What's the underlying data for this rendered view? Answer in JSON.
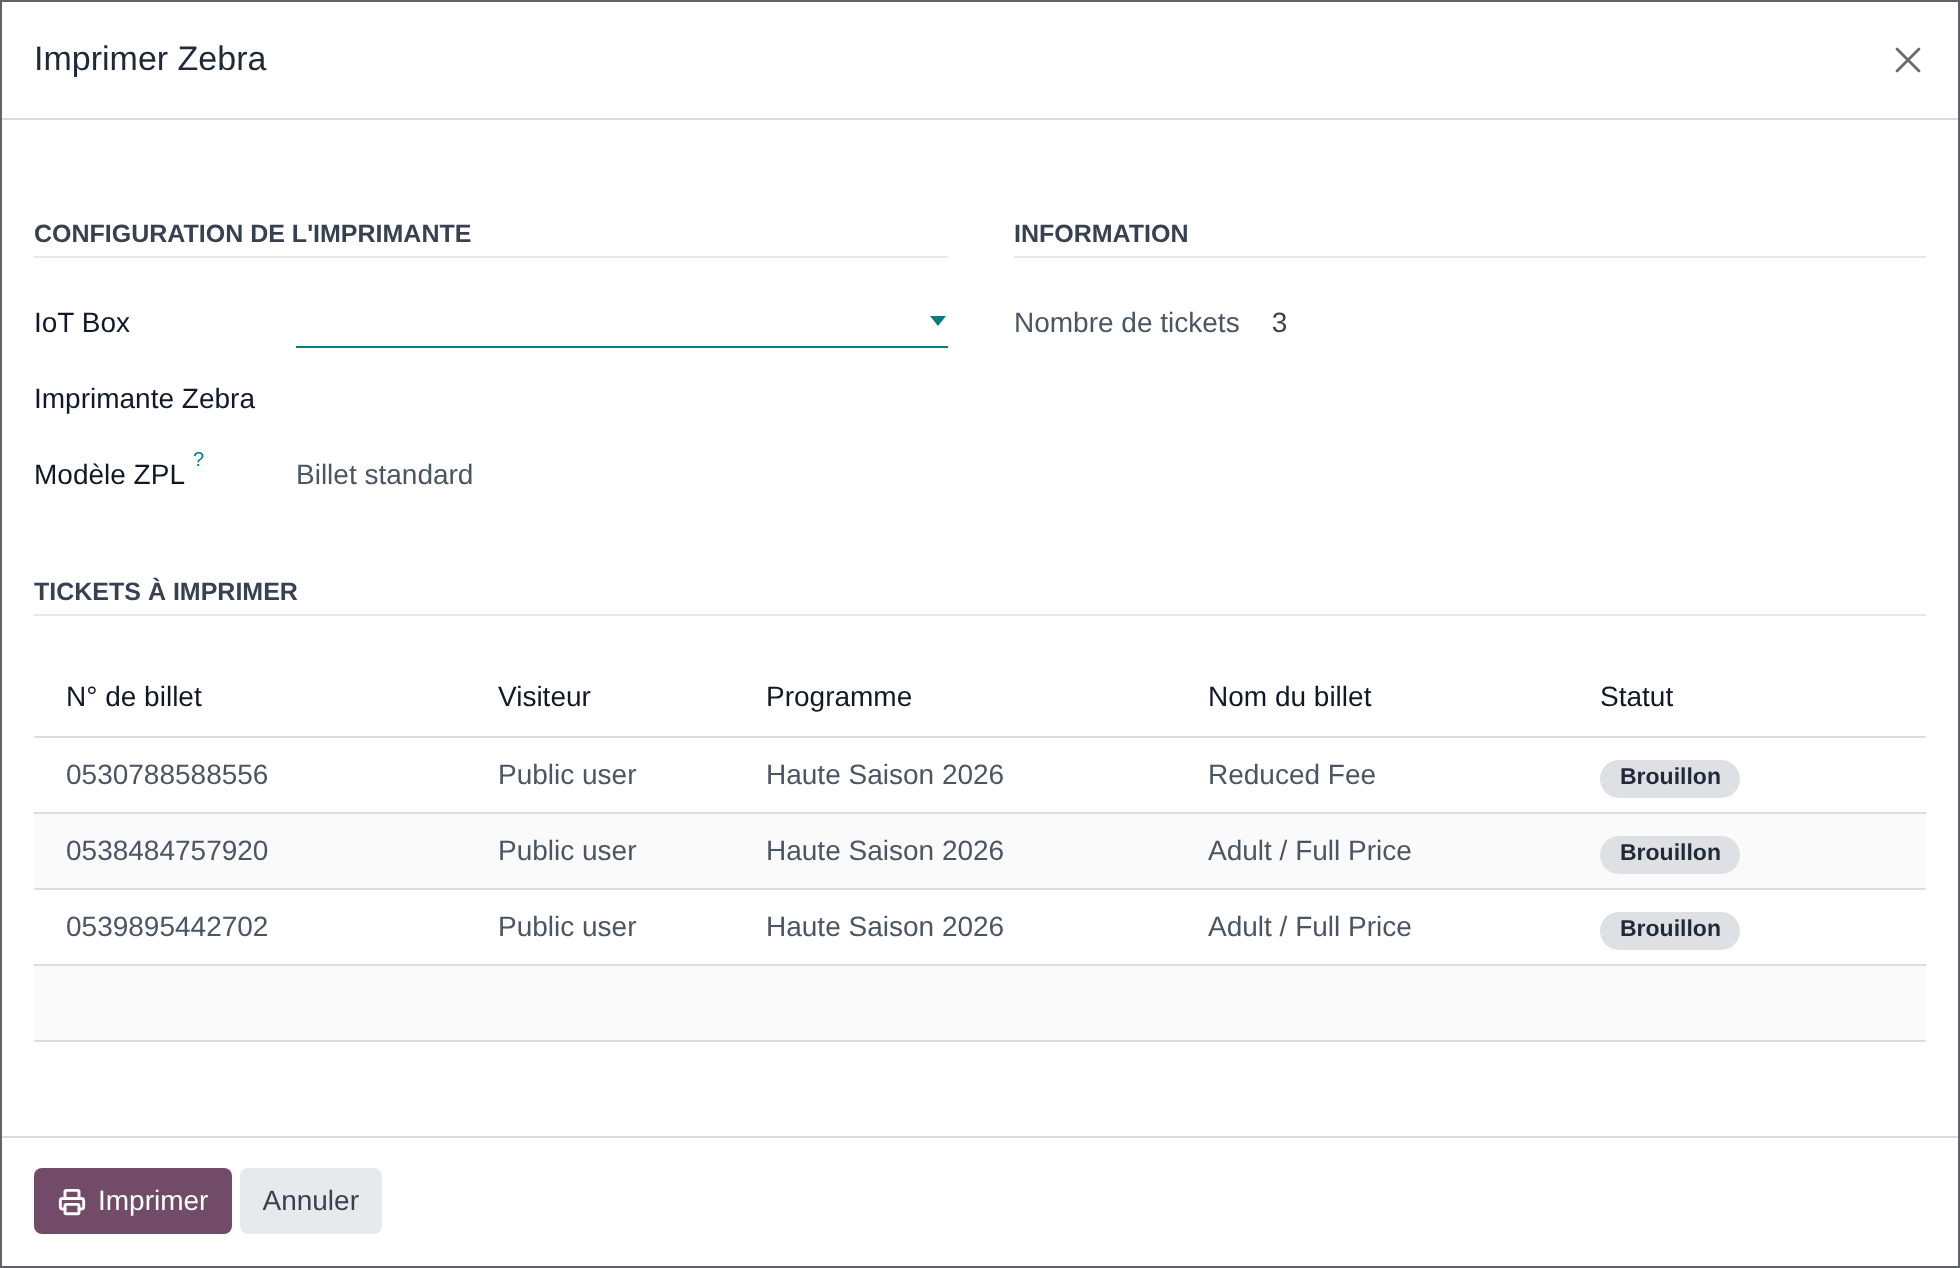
{
  "dialog": {
    "title": "Imprimer Zebra"
  },
  "printer_configuration": {
    "heading": "CONFIGURATION DE L'IMPRIMANTE",
    "fields": [
      {
        "kind": "select",
        "label": "IoT Box",
        "focused": true
      },
      {
        "kind": "blank",
        "label": "Imprimante Zebra"
      },
      {
        "kind": "text",
        "label": "Modèle ZPL",
        "help_mark": "?",
        "value": "Billet standard"
      }
    ]
  },
  "information": {
    "heading": "INFORMATION",
    "fields": [
      {
        "label": "Nombre de tickets",
        "value": "3"
      }
    ]
  },
  "tickets": {
    "heading": "TICKETS À IMPRIMER",
    "columns": [
      "N° de billet",
      "Visiteur",
      "Programme",
      "Nom du billet",
      "Statut"
    ],
    "rows": [
      {
        "ticket_number": "0530788588556",
        "visitor": "Public user",
        "program": "Haute Saison 2026",
        "ticket_name": "Reduced Fee",
        "status": "Brouillon"
      },
      {
        "ticket_number": "0538484757920",
        "visitor": "Public user",
        "program": "Haute Saison 2026",
        "ticket_name": "Adult / Full Price",
        "status": "Brouillon"
      },
      {
        "ticket_number": "0539895442702",
        "visitor": "Public user",
        "program": "Haute Saison 2026",
        "ticket_name": "Adult / Full Price",
        "status": "Brouillon"
      }
    ]
  },
  "footer": {
    "buttons": [
      {
        "kind": "primary",
        "label": "Imprimer"
      },
      {
        "kind": "secondary",
        "label": "Annuler"
      }
    ]
  }
}
